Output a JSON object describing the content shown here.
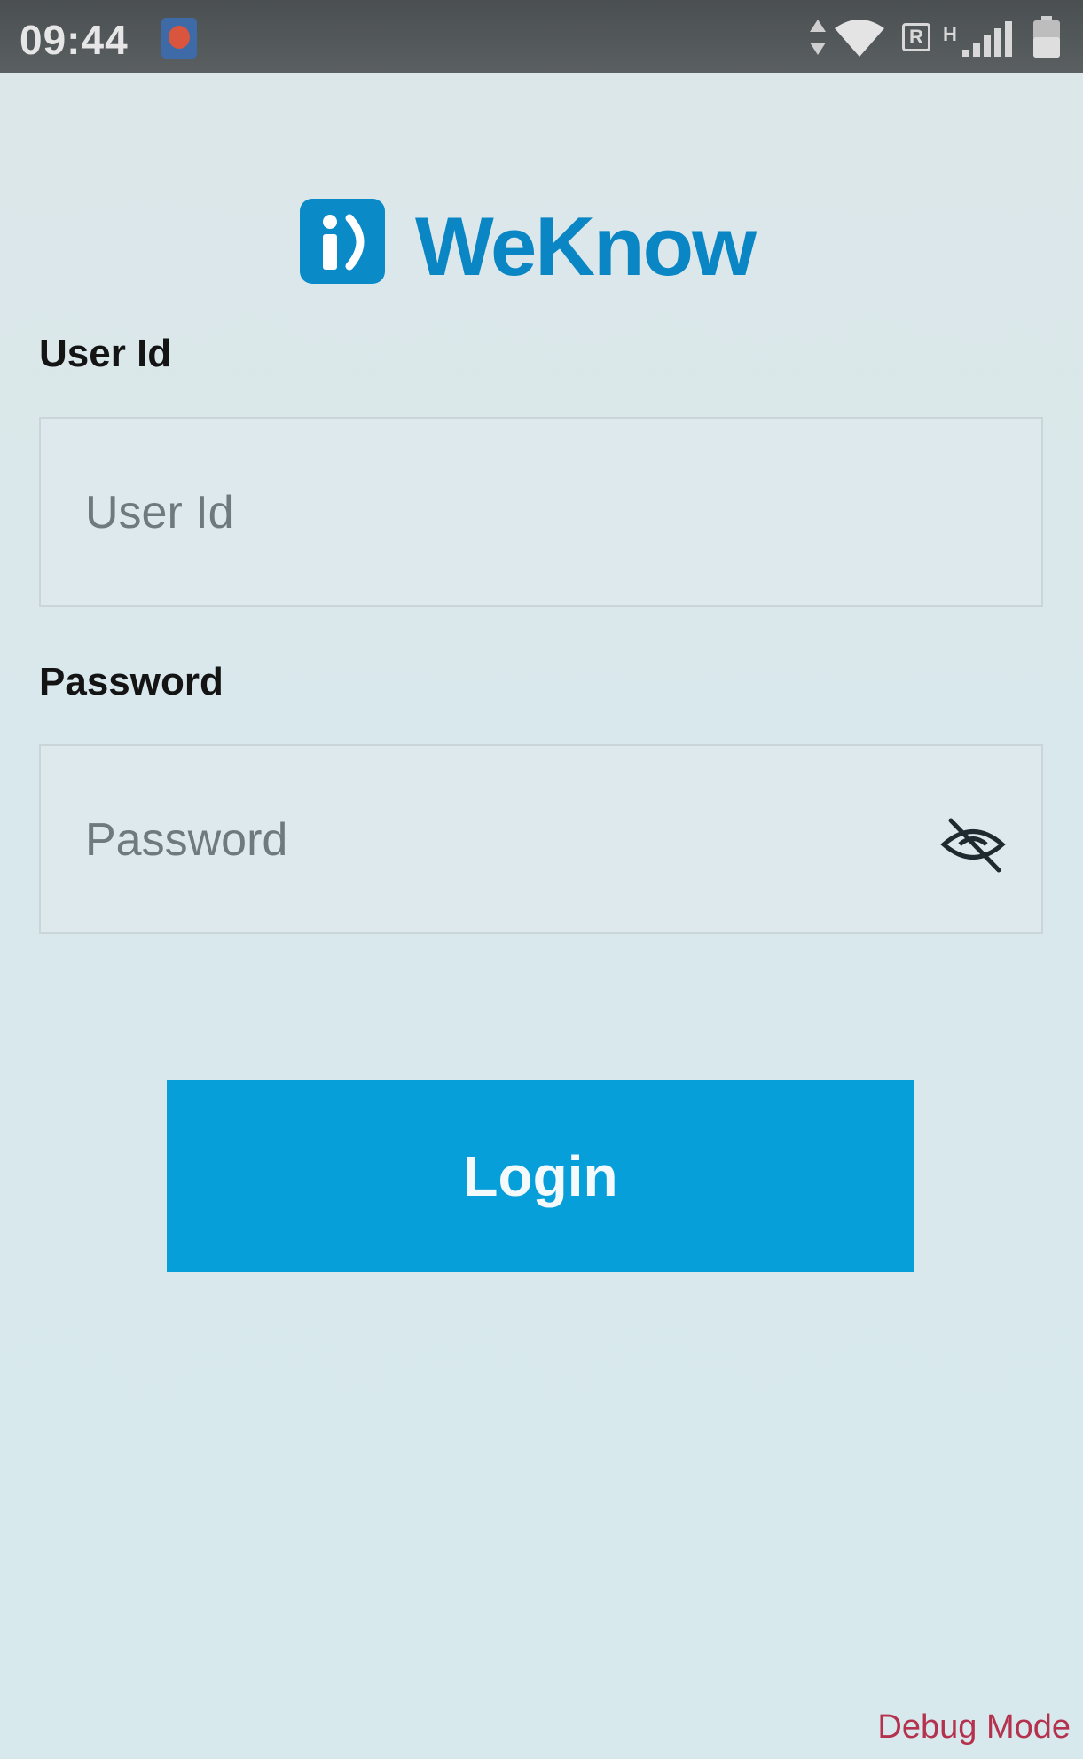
{
  "status_bar": {
    "time": "09:44",
    "icons": [
      "notification-app-icon",
      "data-arrows-icon",
      "wifi-icon",
      "roaming-r-icon",
      "h-signal-icon",
      "battery-icon"
    ],
    "roaming_letter": "R",
    "network_type": "H"
  },
  "logo": {
    "brand": "WeKnow",
    "mark_icon": "info-speech-icon",
    "color": "#0a86c4"
  },
  "form": {
    "user_id": {
      "label": "User Id",
      "placeholder": "User Id",
      "value": ""
    },
    "password": {
      "label": "Password",
      "placeholder": "Password",
      "value": "",
      "toggle_icon": "eye-off-icon"
    }
  },
  "login_button": {
    "label": "Login",
    "color": "#079fd9"
  },
  "debug_label": "Debug Mode",
  "colors": {
    "background": "#dce8ea",
    "status_bar": "#50555a",
    "debug_text": "#b5324f"
  }
}
